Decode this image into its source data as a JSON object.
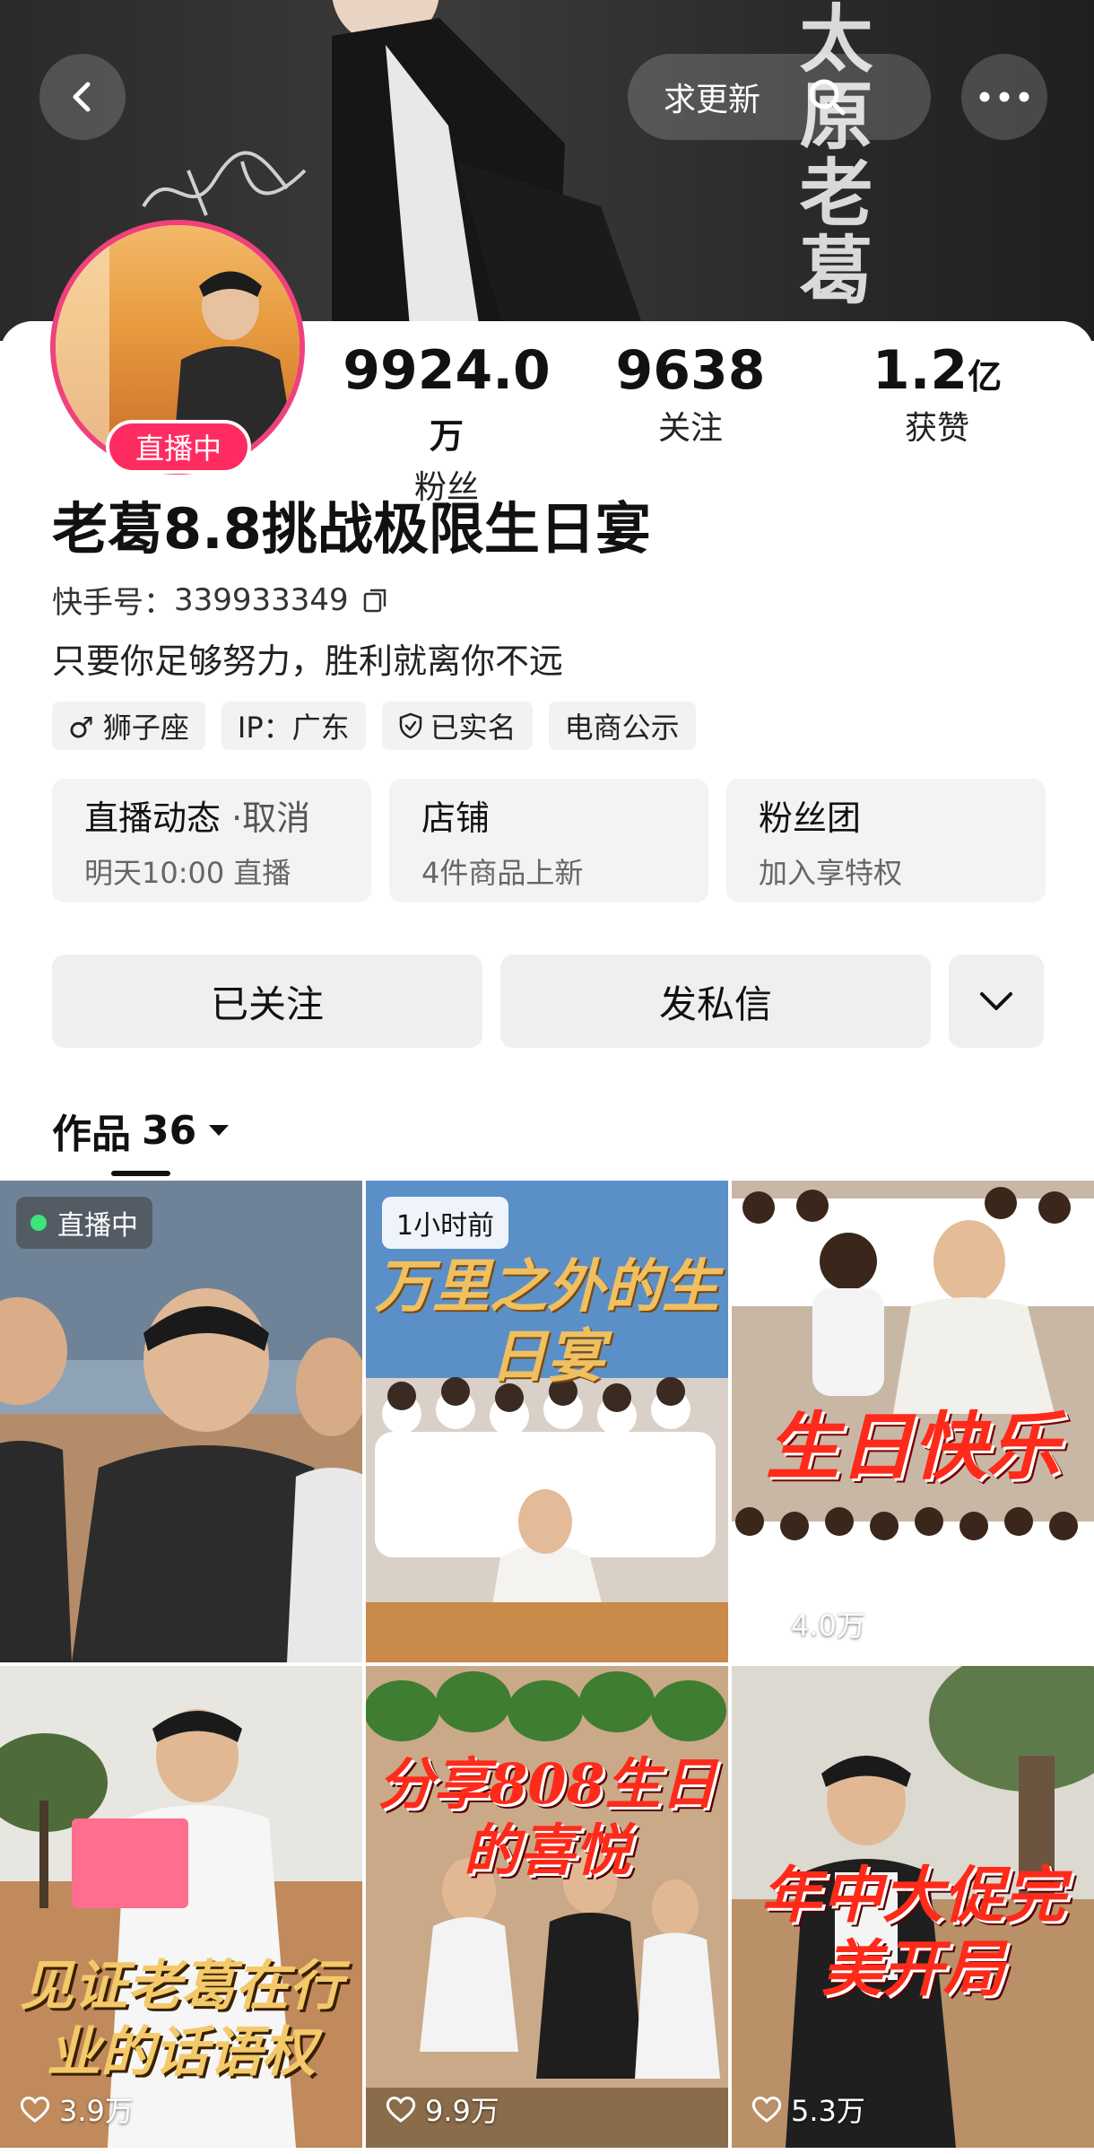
{
  "header": {
    "request_update_label": "求更新",
    "banner_title": "太原老葛"
  },
  "profile": {
    "live_badge": "直播中",
    "name": "老葛8.8挑战极限生日宴",
    "uid_label": "快手号：",
    "uid_value": "339933349",
    "bio": "只要你足够努力，胜利就离你不远",
    "stats": [
      {
        "value": "9924.0",
        "unit": "万",
        "label": "粉丝"
      },
      {
        "value": "9638",
        "unit": "",
        "label": "关注"
      },
      {
        "value": "1.2",
        "unit": "亿",
        "label": "获赞"
      }
    ],
    "tags": [
      "♂ 狮子座",
      "IP：广东",
      "已实名",
      "电商公示"
    ]
  },
  "tiles": [
    {
      "title": "直播动态",
      "title_suffix": " ·取消",
      "subtitle": "明天10:00 直播"
    },
    {
      "title": "店铺",
      "title_suffix": "",
      "subtitle": "4件商品上新"
    },
    {
      "title": "粉丝团",
      "title_suffix": "",
      "subtitle": "加入享特权"
    }
  ],
  "actions": {
    "followed_label": "已关注",
    "message_label": "发私信"
  },
  "works": {
    "label": "作品",
    "count": "36"
  },
  "grid": [
    {
      "badge": "直播中",
      "overlay": "",
      "likes": ""
    },
    {
      "badge": "1小时前",
      "overlay": "万里之外的生日宴",
      "likes": ""
    },
    {
      "badge": "",
      "overlay": "生日快乐",
      "likes": "4.0万"
    },
    {
      "badge": "",
      "overlay": "见证老葛在行业的话语权",
      "likes": "3.9万"
    },
    {
      "badge": "",
      "overlay": "分享808生日的喜悦",
      "likes": "9.9万"
    },
    {
      "badge": "",
      "overlay": "年中大促完美开局",
      "likes": "5.3万"
    }
  ],
  "colors": {
    "accent_pink": "#ff2c62",
    "live_dot": "#3ce47a",
    "tile_bg": "#f3f3f3"
  }
}
